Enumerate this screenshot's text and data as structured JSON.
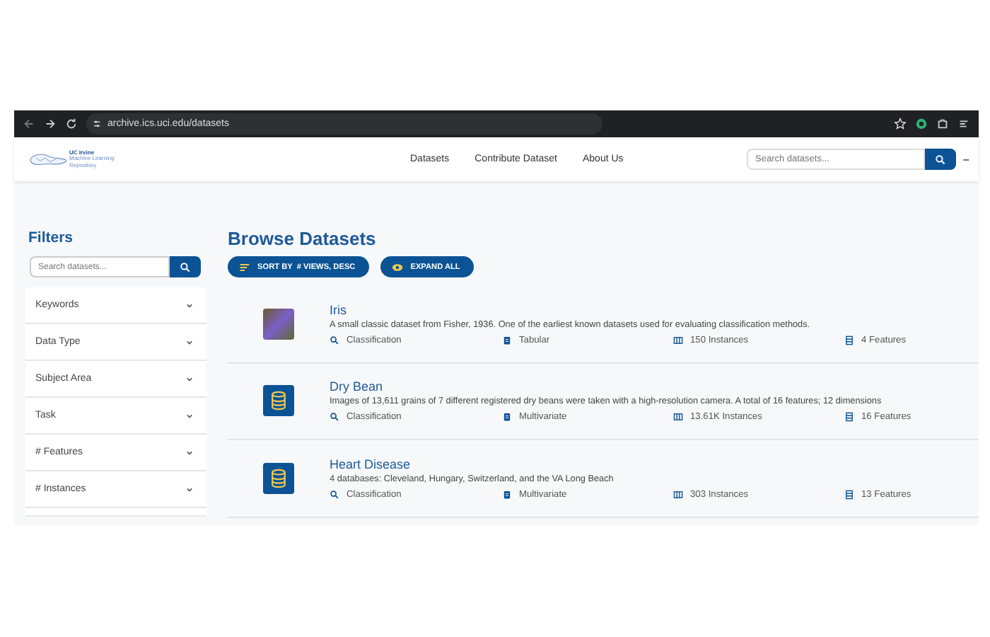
{
  "browser": {
    "url": "archive.ics.uci.edu/datasets"
  },
  "header": {
    "logo_lines": [
      "UC Irvine",
      "Machine Learning",
      "Repository"
    ],
    "nav": [
      "Datasets",
      "Contribute Dataset",
      "About Us"
    ],
    "search": {
      "placeholder": "Search datasets..."
    }
  },
  "filters": {
    "title": "Filters",
    "search": {
      "placeholder": "Search datasets..."
    },
    "items": [
      {
        "label": "Keywords",
        "expanded": false
      },
      {
        "label": "Data Type",
        "expanded": false
      },
      {
        "label": "Subject Area",
        "expanded": false
      },
      {
        "label": "Task",
        "expanded": false
      },
      {
        "label": "# Features",
        "expanded": false
      },
      {
        "label": "# Instances",
        "expanded": false
      }
    ]
  },
  "main": {
    "title": "Browse Datasets",
    "sort_button": "SORT BY  # VIEWS, DESC",
    "expand_button": "EXPAND ALL",
    "datasets": [
      {
        "kind": "photo",
        "name": "Iris",
        "description": "A small classic dataset from Fisher, 1936. One of the earliest known datasets used for evaluating classification methods.",
        "task": "Classification",
        "data_type": "Tabular",
        "instances": "150 Instances",
        "features": "4 Features"
      },
      {
        "kind": "database",
        "name": "Dry Bean",
        "description": "Images of 13,611 grains of 7 different registered dry beans were taken with a high-resolution camera. A total of 16 features; 12 dimensions",
        "task": "Classification",
        "data_type": "Multivariate",
        "instances": "13.61K Instances",
        "features": "16 Features"
      },
      {
        "kind": "database",
        "name": "Heart Disease",
        "description": "4 databases: Cleveland, Hungary, Switzerland, and the VA Long Beach",
        "task": "Classification",
        "data_type": "Multivariate",
        "instances": "303 Instances",
        "features": "13 Features"
      }
    ]
  }
}
